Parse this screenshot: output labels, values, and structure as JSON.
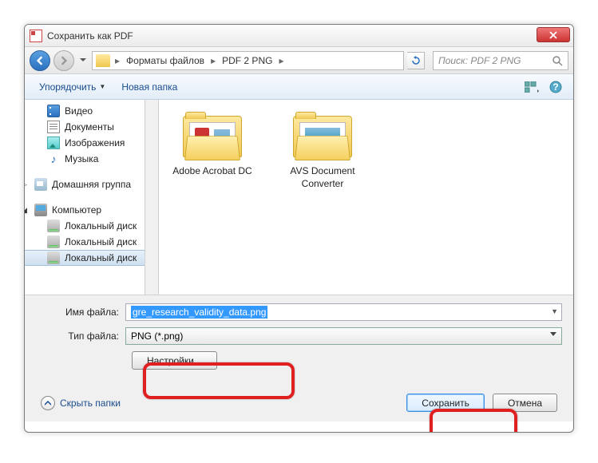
{
  "window": {
    "title": "Сохранить как PDF"
  },
  "nav": {
    "breadcrumb": {
      "seg1": "Форматы файлов",
      "seg2": "PDF 2 PNG"
    },
    "search_placeholder": "Поиск: PDF 2 PNG"
  },
  "toolbar": {
    "organize": "Упорядочить",
    "new_folder": "Новая папка"
  },
  "sidebar": {
    "video": "Видео",
    "documents": "Документы",
    "pictures": "Изображения",
    "music": "Музыка",
    "homegroup": "Домашняя группа",
    "computer": "Компьютер",
    "disk1": "Локальный диск",
    "disk2": "Локальный диск",
    "disk3": "Локальный диск"
  },
  "files": {
    "f1": "Adobe Acrobat DC",
    "f2": "AVS Document Converter"
  },
  "form": {
    "filename_label": "Имя файла:",
    "filename_value": "gre_research_validity_data.png",
    "filetype_label": "Тип файла:",
    "filetype_value": "PNG (*.png)",
    "settings_btn": "Настройки...",
    "hide_folders": "Скрыть папки",
    "save_btn": "Сохранить",
    "cancel_btn": "Отмена"
  }
}
